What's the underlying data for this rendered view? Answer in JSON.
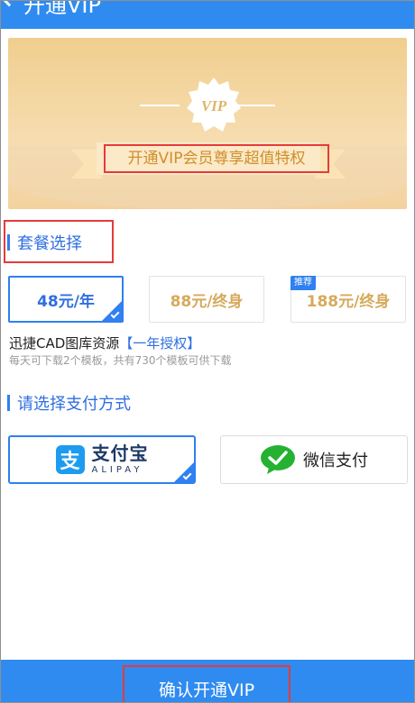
{
  "header": {
    "title": "开通VIP"
  },
  "banner": {
    "badge_text": "VIP",
    "slogan": "开通VIP会员尊享超值特权"
  },
  "plans_section": {
    "title": "套餐选择"
  },
  "plans": [
    {
      "label": "48元/年",
      "selected": true
    },
    {
      "label": "88元/终身",
      "selected": false
    },
    {
      "label": "188元/终身",
      "selected": false,
      "tag": "推荐"
    }
  ],
  "plan_info": {
    "name": "迅捷CAD图库资源",
    "highlight": "【一年授权】",
    "description": "每天可下载2个模板，共有730个模板可供下载"
  },
  "payment_section": {
    "title": "请选择支付方式"
  },
  "payments": {
    "alipay": {
      "name": "支付宝",
      "sub": "ALIPAY",
      "logo_char": "支",
      "selected": true
    },
    "wechat": {
      "name": "微信支付",
      "selected": false
    }
  },
  "footer": {
    "confirm_label": "确认开通VIP"
  },
  "colors": {
    "accent": "#2f80f0",
    "header_bg": "#2f8bf0",
    "gold": "#d6aa5c",
    "highlight_box": "#e43b3b"
  }
}
